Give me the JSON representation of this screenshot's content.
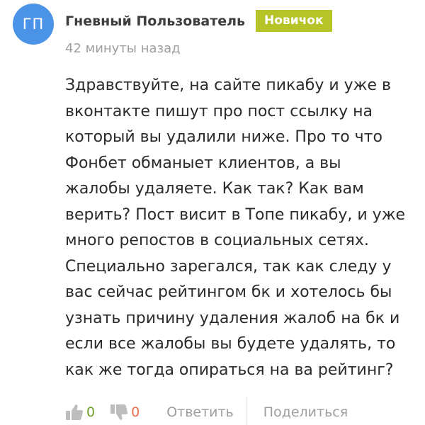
{
  "comment": {
    "author": {
      "initials": "ГП",
      "name": "Гневный Пользователь",
      "badge": "Новичок"
    },
    "time": "42 минуты назад",
    "text_lines": [
      "Здравствуйте, на сайте пикабу и уже в",
      "вконтакте пишут про пост ссылку на",
      "который вы удалили ниже. Про то что",
      "Фонбет обманыет клиентов, а вы",
      "жалобы удаляете. Как так? Как вам",
      "верить? Пост висит в Топе пикабу, и уже",
      "много репостов в социальных сетях.",
      "Специально зарегался, так как следу у",
      "вас сейчас рейтингом бк и хотелось бы",
      "узнать причину удаления жалоб на бк и",
      "если все жалобы вы будете удалять, то",
      "как же тогда опираться на ва рейтинг?"
    ],
    "actions": {
      "likes": "0",
      "dislikes": "0",
      "reply_label": "Ответить",
      "share_label": "Поделиться"
    }
  },
  "colors": {
    "avatar": "#4b93e6",
    "badge": "#b6c427",
    "like_count": "#6f9e2e",
    "dislike_count": "#e4704d",
    "muted": "#9e9e9e"
  },
  "icons": {
    "like": "thumbs-up-icon",
    "dislike": "thumbs-down-icon"
  }
}
